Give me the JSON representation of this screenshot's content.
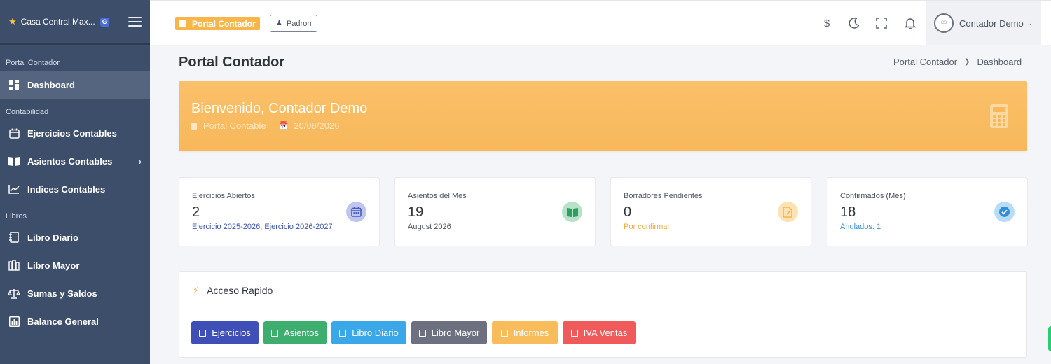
{
  "sidebar": {
    "brand": "Casa Central Max...",
    "brand_badge": "G",
    "sections": {
      "portal": "Portal Contador",
      "contabilidad": "Contabilidad",
      "libros": "Libros"
    },
    "items": {
      "dashboard": "Dashboard",
      "ejercicios": "Ejercicios Contables",
      "asientos": "Asientos Contables",
      "indices": "Indices Contables",
      "libro_diario": "Libro Diario",
      "libro_mayor": "Libro Mayor",
      "sumas_saldos": "Sumas y Saldos",
      "balance": "Balance General"
    }
  },
  "topbar": {
    "portal_pill": "Portal Contador",
    "padron_button": "Padron",
    "user_name": "Contador Demo",
    "icons": [
      "dollar-icon",
      "moon-icon",
      "fullscreen-icon",
      "bell-icon"
    ]
  },
  "page": {
    "title": "Portal Contador",
    "breadcrumb": [
      "Portal Contador",
      "Dashboard"
    ]
  },
  "banner": {
    "title": "Bienvenido, Contador Demo",
    "subtitle": "Portal Contable",
    "date": "20/08/2026",
    "color": "#f8b85a"
  },
  "stats": [
    {
      "label": "Ejercicios Abiertos",
      "value": "2",
      "sub": "Ejercicio 2025-2026, Ejercicio 2026-2027",
      "color": "#4a5bc4"
    },
    {
      "label": "Asientos del Mes",
      "value": "19",
      "sub": "August 2026",
      "color": "#2e9e62"
    },
    {
      "label": "Borradores Pendientes",
      "value": "0",
      "sub": "Por confirmar",
      "color": "#f7b54a"
    },
    {
      "label": "Confirmados (Mes)",
      "value": "18",
      "sub": "Anulados: 1",
      "color": "#2f8fd8"
    }
  ],
  "quick_access": {
    "title": "Acceso Rapido",
    "buttons": [
      {
        "label": "Ejercicios",
        "color": "#3f4fb8"
      },
      {
        "label": "Asientos",
        "color": "#3dae6e"
      },
      {
        "label": "Libro Diario",
        "color": "#3aa8e8"
      },
      {
        "label": "Libro Mayor",
        "color": "#6c7080"
      },
      {
        "label": "Informes",
        "color": "#f8bd5a"
      },
      {
        "label": "IVA Ventas",
        "color": "#f05a5a"
      }
    ]
  }
}
